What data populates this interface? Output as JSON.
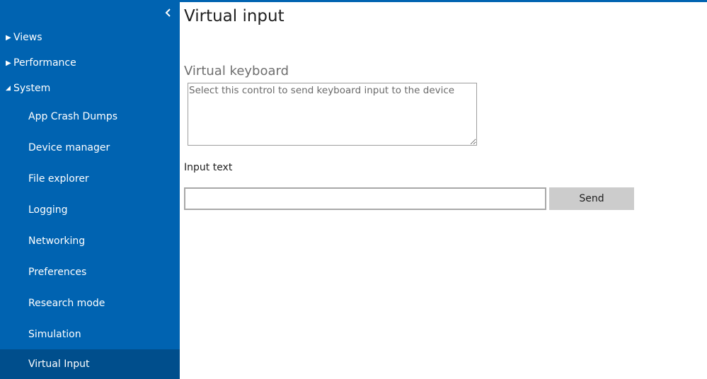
{
  "sidebar": {
    "collapse_icon": "chevron-left-icon",
    "sections": [
      {
        "label": "Views",
        "expanded": false
      },
      {
        "label": "Performance",
        "expanded": false
      },
      {
        "label": "System",
        "expanded": true
      }
    ],
    "items": [
      {
        "label": "App Crash Dumps"
      },
      {
        "label": "Device manager"
      },
      {
        "label": "File explorer"
      },
      {
        "label": "Logging"
      },
      {
        "label": "Networking"
      },
      {
        "label": "Preferences"
      },
      {
        "label": "Research mode"
      },
      {
        "label": "Simulation"
      },
      {
        "label": "Virtual Input",
        "active": true
      }
    ]
  },
  "main": {
    "title": "Virtual input",
    "virtual_keyboard": {
      "label": "Virtual keyboard",
      "placeholder": "Select this control to send keyboard input to the device",
      "value": ""
    },
    "input_text": {
      "label": "Input text",
      "value": ""
    },
    "send_label": "Send"
  },
  "colors": {
    "sidebar_bg": "#0063b1",
    "sidebar_active_bg": "#004e8c",
    "button_bg": "#cccccc"
  }
}
